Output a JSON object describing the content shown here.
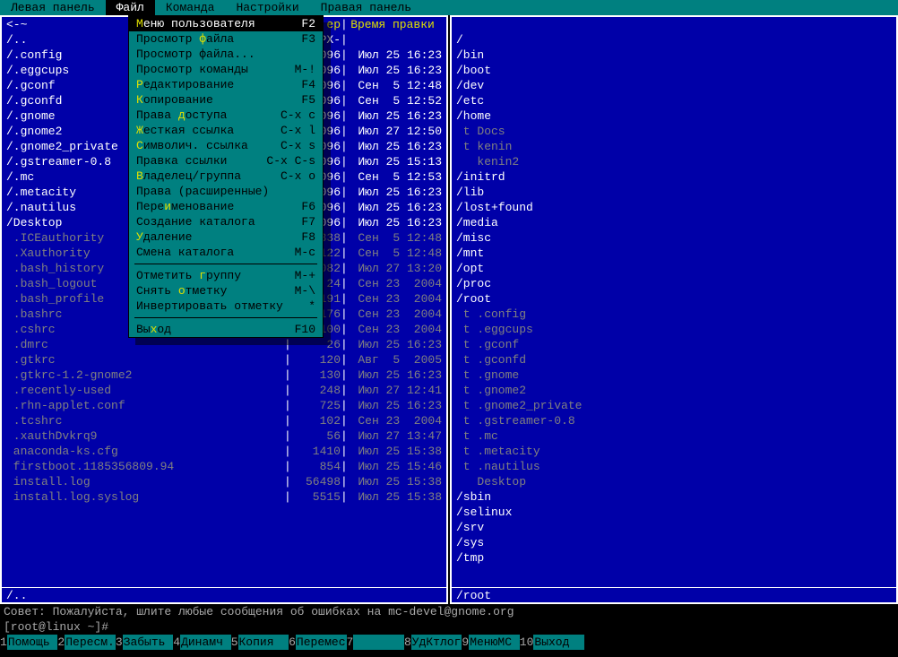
{
  "menubar": {
    "items": [
      "Левая панель",
      "Файл",
      "Команда",
      "Настройки",
      "Правая панель"
    ],
    "activeIndex": 1
  },
  "dropdown": {
    "items": [
      {
        "label": "Меню пользователя",
        "hot": 0,
        "shortcut": "F2",
        "selected": true
      },
      {
        "label": "Просмотр файла",
        "hot": 9,
        "shortcut": "F3"
      },
      {
        "label": "Просмотр файла...",
        "hot": -1,
        "shortcut": ""
      },
      {
        "label": "Просмотр команды",
        "hot": -1,
        "shortcut": "M-!"
      },
      {
        "label": "Редактирование",
        "hot": 0,
        "shortcut": "F4"
      },
      {
        "label": "Копирование",
        "hot": 0,
        "shortcut": "F5"
      },
      {
        "label": "Права доступа",
        "hot": 6,
        "shortcut": "C-x c"
      },
      {
        "label": "Жесткая ссылка",
        "hot": 0,
        "shortcut": "C-x l"
      },
      {
        "label": "Символич. ссылка",
        "hot": 0,
        "shortcut": "C-x s"
      },
      {
        "label": "Правка ссылки",
        "hot": -1,
        "shortcut": "C-x C-s"
      },
      {
        "label": "Владелец/группа",
        "hot": 0,
        "shortcut": "C-x o"
      },
      {
        "label": "Права (расширенные)",
        "hot": -1,
        "shortcut": ""
      },
      {
        "label": "Переименование",
        "hot": 4,
        "shortcut": "F6"
      },
      {
        "label": "Создание каталога",
        "hot": -1,
        "shortcut": "F7"
      },
      {
        "label": "Удаление",
        "hot": 0,
        "shortcut": "F8"
      },
      {
        "label": "Смена каталога",
        "hot": -1,
        "shortcut": "M-c"
      },
      {
        "sep": true
      },
      {
        "label": "Отметить группу",
        "hot": 9,
        "shortcut": "M-+"
      },
      {
        "label": "Снять отметку",
        "hot": 6,
        "shortcut": "M-\\"
      },
      {
        "label": "Инвертировать отметку",
        "hot": -1,
        "shortcut": "*"
      },
      {
        "sep": true
      },
      {
        "label": "Выход",
        "hot": 2,
        "shortcut": "F10"
      }
    ]
  },
  "leftPanel": {
    "headerCaret": "<-~",
    "colSize": "ер",
    "colDate": "Время правки",
    "rows": [
      {
        "n": "/..",
        "s": "PX-",
        "d": "",
        "cls": "dir"
      },
      {
        "n": "/.config",
        "s": "096",
        "d": "Июл 25 16:23",
        "cls": "dir"
      },
      {
        "n": "/.eggcups",
        "s": "096",
        "d": "Июл 25 16:23",
        "cls": "dir"
      },
      {
        "n": "/.gconf",
        "s": "096",
        "d": "Сен  5 12:48",
        "cls": "dir"
      },
      {
        "n": "/.gconfd",
        "s": "096",
        "d": "Сен  5 12:52",
        "cls": "dir"
      },
      {
        "n": "/.gnome",
        "s": "096",
        "d": "Июл 25 16:23",
        "cls": "dir"
      },
      {
        "n": "/.gnome2",
        "s": "096",
        "d": "Июл 27 12:50",
        "cls": "dir"
      },
      {
        "n": "/.gnome2_private",
        "s": "096",
        "d": "Июл 25 16:23",
        "cls": "dir"
      },
      {
        "n": "/.gstreamer-0.8",
        "s": "096",
        "d": "Июл 25 15:13",
        "cls": "dir"
      },
      {
        "n": "/.mc",
        "s": "096",
        "d": "Сен  5 12:53",
        "cls": "dir"
      },
      {
        "n": "/.metacity",
        "s": "096",
        "d": "Июл 25 16:23",
        "cls": "dir"
      },
      {
        "n": "/.nautilus",
        "s": "096",
        "d": "Июл 25 16:23",
        "cls": "dir"
      },
      {
        "n": "/Desktop",
        "s": "096",
        "d": "Июл 25 16:23",
        "cls": "dir"
      },
      {
        "n": " .ICEauthority",
        "s": "338",
        "d": "Сен  5 12:48",
        "cls": "hfile"
      },
      {
        "n": " .Xauthority",
        "s": "122",
        "d": "Сен  5 12:48",
        "cls": "hfile"
      },
      {
        "n": " .bash_history",
        "s": "082",
        "d": "Июл 27 13:20",
        "cls": "hfile"
      },
      {
        "n": " .bash_logout",
        "s": "24",
        "d": "Сен 23  2004",
        "cls": "hfile"
      },
      {
        "n": " .bash_profile",
        "s": "191",
        "d": "Сен 23  2004",
        "cls": "hfile"
      },
      {
        "n": " .bashrc",
        "s": "176",
        "d": "Сен 23  2004",
        "cls": "hfile"
      },
      {
        "n": " .cshrc",
        "s": "100",
        "d": "Сен 23  2004",
        "cls": "hfile"
      },
      {
        "n": " .dmrc",
        "s": "26",
        "d": "Июл 25 16:23",
        "cls": "hfile"
      },
      {
        "n": " .gtkrc",
        "s": "120",
        "d": "Авг  5  2005",
        "cls": "hfile"
      },
      {
        "n": " .gtkrc-1.2-gnome2",
        "s": "130",
        "d": "Июл 25 16:23",
        "cls": "hfile"
      },
      {
        "n": " .recently-used",
        "s": "248",
        "d": "Июл 27 12:41",
        "cls": "hfile"
      },
      {
        "n": " .rhn-applet.conf",
        "s": "725",
        "d": "Июл 25 16:23",
        "cls": "hfile"
      },
      {
        "n": " .tcshrc",
        "s": "102",
        "d": "Сен 23  2004",
        "cls": "hfile"
      },
      {
        "n": " .xauthDvkrq9",
        "s": "56",
        "d": "Июл 27 13:47",
        "cls": "hfile"
      },
      {
        "n": " anaconda-ks.cfg",
        "s": "1410",
        "d": "Июл 25 15:38",
        "cls": "hfile"
      },
      {
        "n": " firstboot.1185356809.94",
        "s": "854",
        "d": "Июл 25 15:46",
        "cls": "hfile"
      },
      {
        "n": " install.log",
        "s": "56498",
        "d": "Июл 25 15:38",
        "cls": "hfile"
      },
      {
        "n": " install.log.syslog",
        "s": "5515",
        "d": "Июл 25 15:38",
        "cls": "hfile"
      }
    ],
    "footer": "/.."
  },
  "rightPanel": {
    "headerCaret": "",
    "rows": [
      {
        "n": "/",
        "cls": "dir"
      },
      {
        "n": "/bin",
        "cls": "dir"
      },
      {
        "n": "/boot",
        "cls": "dir"
      },
      {
        "n": "/dev",
        "cls": "dir"
      },
      {
        "n": "/etc",
        "cls": "dir"
      },
      {
        "n": "/home",
        "cls": "dir"
      },
      {
        "n": " t Docs",
        "cls": "hfile"
      },
      {
        "n": " t kenin",
        "cls": "hfile"
      },
      {
        "n": "   kenin2",
        "cls": "hfile"
      },
      {
        "n": "/initrd",
        "cls": "dir"
      },
      {
        "n": "/lib",
        "cls": "dir"
      },
      {
        "n": "/lost+found",
        "cls": "dir"
      },
      {
        "n": "/media",
        "cls": "dir"
      },
      {
        "n": "/misc",
        "cls": "dir"
      },
      {
        "n": "/mnt",
        "cls": "dir"
      },
      {
        "n": "/opt",
        "cls": "dir"
      },
      {
        "n": "/proc",
        "cls": "dir"
      },
      {
        "n": "/root",
        "cls": "dir"
      },
      {
        "n": " t .config",
        "cls": "hfile"
      },
      {
        "n": " t .eggcups",
        "cls": "hfile"
      },
      {
        "n": " t .gconf",
        "cls": "hfile"
      },
      {
        "n": " t .gconfd",
        "cls": "hfile"
      },
      {
        "n": " t .gnome",
        "cls": "hfile"
      },
      {
        "n": " t .gnome2",
        "cls": "hfile"
      },
      {
        "n": " t .gnome2_private",
        "cls": "hfile"
      },
      {
        "n": " t .gstreamer-0.8",
        "cls": "hfile"
      },
      {
        "n": " t .mc",
        "cls": "hfile"
      },
      {
        "n": " t .metacity",
        "cls": "hfile"
      },
      {
        "n": " t .nautilus",
        "cls": "hfile"
      },
      {
        "n": "   Desktop",
        "cls": "hfile"
      },
      {
        "n": "/sbin",
        "cls": "dir"
      },
      {
        "n": "/selinux",
        "cls": "dir"
      },
      {
        "n": "/srv",
        "cls": "dir"
      },
      {
        "n": "/sys",
        "cls": "dir"
      },
      {
        "n": "/tmp",
        "cls": "dir"
      }
    ],
    "footer": "/root"
  },
  "hint": "Совет: Пожалуйста, шлите любые сообщения об ошибках на mc-devel@gnome.org",
  "prompt": "[root@linux ~]#",
  "fnkeys": [
    {
      "n": "1",
      "l": "Помощь"
    },
    {
      "n": "2",
      "l": "Пересм."
    },
    {
      "n": "3",
      "l": "Забыть"
    },
    {
      "n": "4",
      "l": "Динамч"
    },
    {
      "n": "5",
      "l": "Копия"
    },
    {
      "n": "6",
      "l": "Перемес"
    },
    {
      "n": "7",
      "l": ""
    },
    {
      "n": "8",
      "l": "УдКтлог"
    },
    {
      "n": "9",
      "l": "МенюMC"
    },
    {
      "n": "10",
      "l": "Выход"
    }
  ]
}
